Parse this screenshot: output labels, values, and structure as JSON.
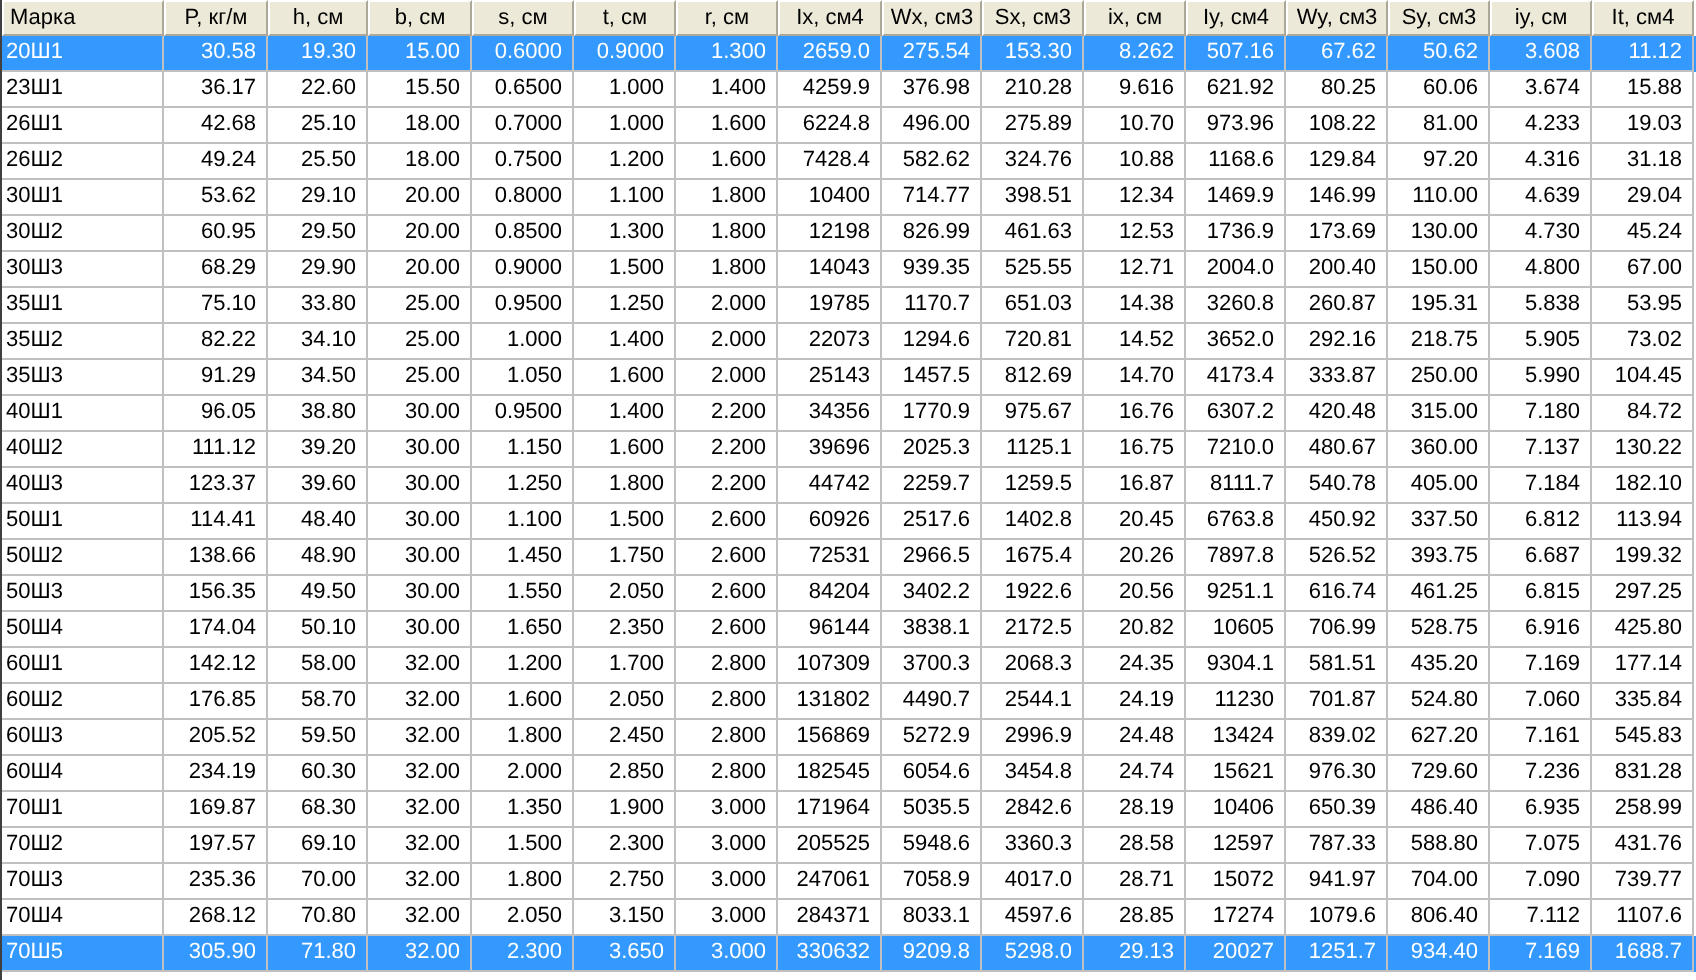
{
  "table": {
    "columns": [
      "Марка",
      "P, кг/м",
      "h, см",
      "b, см",
      "s, см",
      "t, см",
      "r, см",
      "Ix, см4",
      "Wx, см3",
      "Sx, см3",
      "ix, см",
      "Iy, см4",
      "Wy, см3",
      "Sy, см3",
      "iy, см",
      "It, см4"
    ],
    "rows": [
      {
        "selected": true,
        "cells": [
          "20Ш1",
          "30.58",
          "19.30",
          "15.00",
          "0.6000",
          "0.9000",
          "1.300",
          "2659.0",
          "275.54",
          "153.30",
          "8.262",
          "507.16",
          "67.62",
          "50.62",
          "3.608",
          "11.12"
        ]
      },
      {
        "selected": false,
        "cells": [
          "23Ш1",
          "36.17",
          "22.60",
          "15.50",
          "0.6500",
          "1.000",
          "1.400",
          "4259.9",
          "376.98",
          "210.28",
          "9.616",
          "621.92",
          "80.25",
          "60.06",
          "3.674",
          "15.88"
        ]
      },
      {
        "selected": false,
        "cells": [
          "26Ш1",
          "42.68",
          "25.10",
          "18.00",
          "0.7000",
          "1.000",
          "1.600",
          "6224.8",
          "496.00",
          "275.89",
          "10.70",
          "973.96",
          "108.22",
          "81.00",
          "4.233",
          "19.03"
        ]
      },
      {
        "selected": false,
        "cells": [
          "26Ш2",
          "49.24",
          "25.50",
          "18.00",
          "0.7500",
          "1.200",
          "1.600",
          "7428.4",
          "582.62",
          "324.76",
          "10.88",
          "1168.6",
          "129.84",
          "97.20",
          "4.316",
          "31.18"
        ]
      },
      {
        "selected": false,
        "cells": [
          "30Ш1",
          "53.62",
          "29.10",
          "20.00",
          "0.8000",
          "1.100",
          "1.800",
          "10400",
          "714.77",
          "398.51",
          "12.34",
          "1469.9",
          "146.99",
          "110.00",
          "4.639",
          "29.04"
        ]
      },
      {
        "selected": false,
        "cells": [
          "30Ш2",
          "60.95",
          "29.50",
          "20.00",
          "0.8500",
          "1.300",
          "1.800",
          "12198",
          "826.99",
          "461.63",
          "12.53",
          "1736.9",
          "173.69",
          "130.00",
          "4.730",
          "45.24"
        ]
      },
      {
        "selected": false,
        "cells": [
          "30Ш3",
          "68.29",
          "29.90",
          "20.00",
          "0.9000",
          "1.500",
          "1.800",
          "14043",
          "939.35",
          "525.55",
          "12.71",
          "2004.0",
          "200.40",
          "150.00",
          "4.800",
          "67.00"
        ]
      },
      {
        "selected": false,
        "cells": [
          "35Ш1",
          "75.10",
          "33.80",
          "25.00",
          "0.9500",
          "1.250",
          "2.000",
          "19785",
          "1170.7",
          "651.03",
          "14.38",
          "3260.8",
          "260.87",
          "195.31",
          "5.838",
          "53.95"
        ]
      },
      {
        "selected": false,
        "cells": [
          "35Ш2",
          "82.22",
          "34.10",
          "25.00",
          "1.000",
          "1.400",
          "2.000",
          "22073",
          "1294.6",
          "720.81",
          "14.52",
          "3652.0",
          "292.16",
          "218.75",
          "5.905",
          "73.02"
        ]
      },
      {
        "selected": false,
        "cells": [
          "35Ш3",
          "91.29",
          "34.50",
          "25.00",
          "1.050",
          "1.600",
          "2.000",
          "25143",
          "1457.5",
          "812.69",
          "14.70",
          "4173.4",
          "333.87",
          "250.00",
          "5.990",
          "104.45"
        ]
      },
      {
        "selected": false,
        "cells": [
          "40Ш1",
          "96.05",
          "38.80",
          "30.00",
          "0.9500",
          "1.400",
          "2.200",
          "34356",
          "1770.9",
          "975.67",
          "16.76",
          "6307.2",
          "420.48",
          "315.00",
          "7.180",
          "84.72"
        ]
      },
      {
        "selected": false,
        "cells": [
          "40Ш2",
          "111.12",
          "39.20",
          "30.00",
          "1.150",
          "1.600",
          "2.200",
          "39696",
          "2025.3",
          "1125.1",
          "16.75",
          "7210.0",
          "480.67",
          "360.00",
          "7.137",
          "130.22"
        ]
      },
      {
        "selected": false,
        "cells": [
          "40Ш3",
          "123.37",
          "39.60",
          "30.00",
          "1.250",
          "1.800",
          "2.200",
          "44742",
          "2259.7",
          "1259.5",
          "16.87",
          "8111.7",
          "540.78",
          "405.00",
          "7.184",
          "182.10"
        ]
      },
      {
        "selected": false,
        "cells": [
          "50Ш1",
          "114.41",
          "48.40",
          "30.00",
          "1.100",
          "1.500",
          "2.600",
          "60926",
          "2517.6",
          "1402.8",
          "20.45",
          "6763.8",
          "450.92",
          "337.50",
          "6.812",
          "113.94"
        ]
      },
      {
        "selected": false,
        "cells": [
          "50Ш2",
          "138.66",
          "48.90",
          "30.00",
          "1.450",
          "1.750",
          "2.600",
          "72531",
          "2966.5",
          "1675.4",
          "20.26",
          "7897.8",
          "526.52",
          "393.75",
          "6.687",
          "199.32"
        ]
      },
      {
        "selected": false,
        "cells": [
          "50Ш3",
          "156.35",
          "49.50",
          "30.00",
          "1.550",
          "2.050",
          "2.600",
          "84204",
          "3402.2",
          "1922.6",
          "20.56",
          "9251.1",
          "616.74",
          "461.25",
          "6.815",
          "297.25"
        ]
      },
      {
        "selected": false,
        "cells": [
          "50Ш4",
          "174.04",
          "50.10",
          "30.00",
          "1.650",
          "2.350",
          "2.600",
          "96144",
          "3838.1",
          "2172.5",
          "20.82",
          "10605",
          "706.99",
          "528.75",
          "6.916",
          "425.80"
        ]
      },
      {
        "selected": false,
        "cells": [
          "60Ш1",
          "142.12",
          "58.00",
          "32.00",
          "1.200",
          "1.700",
          "2.800",
          "107309",
          "3700.3",
          "2068.3",
          "24.35",
          "9304.1",
          "581.51",
          "435.20",
          "7.169",
          "177.14"
        ]
      },
      {
        "selected": false,
        "cells": [
          "60Ш2",
          "176.85",
          "58.70",
          "32.00",
          "1.600",
          "2.050",
          "2.800",
          "131802",
          "4490.7",
          "2544.1",
          "24.19",
          "11230",
          "701.87",
          "524.80",
          "7.060",
          "335.84"
        ]
      },
      {
        "selected": false,
        "cells": [
          "60Ш3",
          "205.52",
          "59.50",
          "32.00",
          "1.800",
          "2.450",
          "2.800",
          "156869",
          "5272.9",
          "2996.9",
          "24.48",
          "13424",
          "839.02",
          "627.20",
          "7.161",
          "545.83"
        ]
      },
      {
        "selected": false,
        "cells": [
          "60Ш4",
          "234.19",
          "60.30",
          "32.00",
          "2.000",
          "2.850",
          "2.800",
          "182545",
          "6054.6",
          "3454.8",
          "24.74",
          "15621",
          "976.30",
          "729.60",
          "7.236",
          "831.28"
        ]
      },
      {
        "selected": false,
        "cells": [
          "70Ш1",
          "169.87",
          "68.30",
          "32.00",
          "1.350",
          "1.900",
          "3.000",
          "171964",
          "5035.5",
          "2842.6",
          "28.19",
          "10406",
          "650.39",
          "486.40",
          "6.935",
          "258.99"
        ]
      },
      {
        "selected": false,
        "cells": [
          "70Ш2",
          "197.57",
          "69.10",
          "32.00",
          "1.500",
          "2.300",
          "3.000",
          "205525",
          "5948.6",
          "3360.3",
          "28.58",
          "12597",
          "787.33",
          "588.80",
          "7.075",
          "431.76"
        ]
      },
      {
        "selected": false,
        "cells": [
          "70Ш3",
          "235.36",
          "70.00",
          "32.00",
          "1.800",
          "2.750",
          "3.000",
          "247061",
          "7058.9",
          "4017.0",
          "28.71",
          "15072",
          "941.97",
          "704.00",
          "7.090",
          "739.77"
        ]
      },
      {
        "selected": false,
        "cells": [
          "70Ш4",
          "268.12",
          "70.80",
          "32.00",
          "2.050",
          "3.150",
          "3.000",
          "284371",
          "8033.1",
          "4597.6",
          "28.85",
          "17274",
          "1079.6",
          "806.40",
          "7.112",
          "1107.6"
        ]
      },
      {
        "selected": true,
        "cells": [
          "70Ш5",
          "305.90",
          "71.80",
          "32.00",
          "2.300",
          "3.650",
          "3.000",
          "330632",
          "9209.8",
          "5298.0",
          "29.13",
          "20027",
          "1251.7",
          "934.40",
          "7.169",
          "1688.7"
        ]
      }
    ]
  }
}
